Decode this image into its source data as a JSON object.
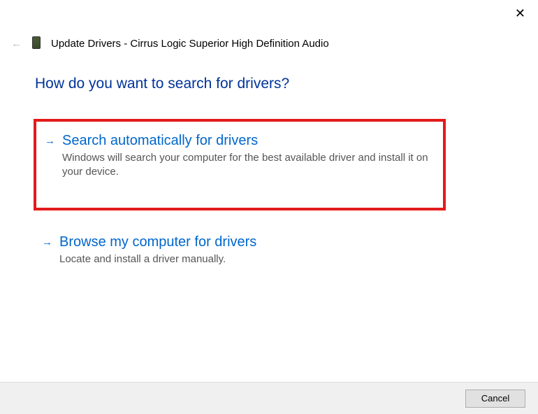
{
  "header": {
    "title": "Update Drivers - Cirrus Logic Superior High Definition Audio"
  },
  "question": "How do you want to search for drivers?",
  "options": [
    {
      "title": "Search automatically for drivers",
      "description": "Windows will search your computer for the best available driver and install it on your device.",
      "highlighted": true
    },
    {
      "title": "Browse my computer for drivers",
      "description": "Locate and install a driver manually.",
      "highlighted": false
    }
  ],
  "footer": {
    "cancel_label": "Cancel"
  }
}
